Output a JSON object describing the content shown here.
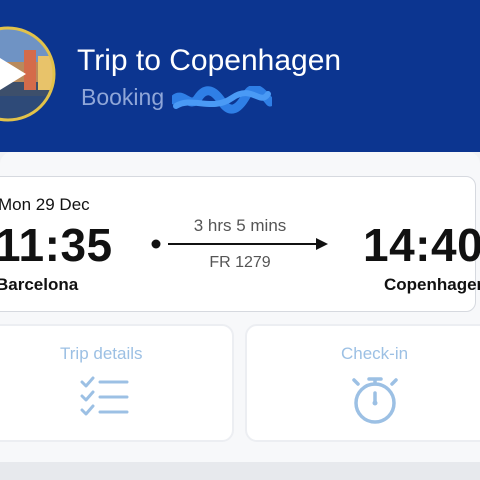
{
  "header": {
    "title": "Trip to Copenhagen",
    "subtitle": "Booking",
    "thumbnail_icon": "play-icon",
    "background": "#0c3590"
  },
  "flight": {
    "date": "Mon 29 Dec",
    "departure_time": "11:35",
    "departure_city": "Barcelona",
    "arrival_time": "14:40",
    "arrival_city": "Copenhagen",
    "duration": "3 hrs 5 mins",
    "flight_number": "FR 1279"
  },
  "actions": {
    "trip_details": {
      "label": "Trip details",
      "icon": "checklist-icon"
    },
    "check_in": {
      "label": "Check-in",
      "icon": "stopwatch-icon"
    }
  },
  "colors": {
    "accent_light": "#9cc0e4",
    "text_dark": "#111111"
  }
}
